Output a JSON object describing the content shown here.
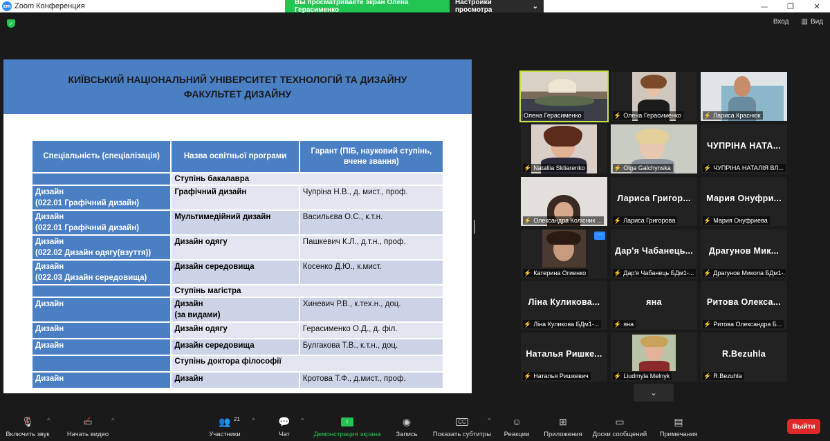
{
  "window": {
    "title": "Zoom Конференция",
    "logo": "zm",
    "share_banner": "Вы просматриваете экран Олена Герасименко",
    "view_settings": "Настройки просмотра"
  },
  "top": {
    "enter_label": "Вход",
    "view_label": "Вид"
  },
  "slide": {
    "title_line1": "КИЇВСЬКИЙ НАЦІОНАЛЬНИЙ УНІВЕРСИТЕТ  ТЕХНОЛОГІЙ ТА ДИЗАЙНУ",
    "title_line2": "ФАКУЛЬТЕТ  ДИЗАЙНУ",
    "headers": {
      "specialty": "Спеціальність (спеціалізація)",
      "program": "Назва освітньої програми",
      "guarantor": "Гарант (ПІБ, науковий ступінь, вчене звання)"
    },
    "level_bachelor": "Ступінь бакалавра",
    "level_master": "Ступінь магістра",
    "level_phd": "Ступінь доктора філософії",
    "rows": [
      {
        "spec1": "Дизайн",
        "spec2": "(022.01 Графічний дизайн)",
        "prog1": "Графічний дизайн",
        "prog2": "",
        "gar": "Чупріна Н.В., д. мист., проф."
      },
      {
        "spec1": "Дизайн",
        "spec2": "(022.01 Графічний дизайн)",
        "prog1": "Мультимедійний дизайн",
        "prog2": "",
        "gar": "Васильєва О.С., к.т.н."
      },
      {
        "spec1": "Дизайн",
        "spec2": "(022.02 Дизайн одягу(взуття))",
        "prog1": "Дизайн одягу",
        "prog2": "",
        "gar": "Пашкевич К.Л., д.т.н., проф."
      },
      {
        "spec1": "Дизайн",
        "spec2": "(022.03 Дизайн середовища)",
        "prog1": "Дизайн середовища",
        "prog2": "",
        "gar": "Косенко Д.Ю., к.мист."
      },
      {
        "spec1": "Дизайн",
        "spec2": "",
        "prog1": "Дизайн",
        "prog2": "(за видами)",
        "gar": "Хиневич Р.В., к.тех.н., доц."
      },
      {
        "spec1": "Дизайн",
        "spec2": "",
        "prog1": "Дизайн одягу",
        "prog2": "",
        "gar": "Герасименко О.Д., д. філ."
      },
      {
        "spec1": "Дизайн",
        "spec2": "",
        "prog1": "Дизайн середовища",
        "prog2": "",
        "gar": "Булгакова Т.В., к.т.н., доц."
      },
      {
        "spec1": "Дизайн",
        "spec2": "",
        "prog1": "Дизайн",
        "prog2": "",
        "gar": "Кротова Т.Ф., д.мист., проф."
      }
    ]
  },
  "participants": [
    {
      "label": "Олена Герасименко",
      "big": "",
      "muted": false
    },
    {
      "label": "Олена Герасименко",
      "big": "",
      "muted": true
    },
    {
      "label": "Лариса Краснюк",
      "big": "",
      "muted": true
    },
    {
      "label": "Nataliia Skliarenko",
      "big": "",
      "muted": true
    },
    {
      "label": "Olga Galchynska",
      "big": "",
      "muted": true
    },
    {
      "label": "ЧУПРІНА НАТАЛІЯ ВЛ...",
      "big": "ЧУПРІНА НАТА...",
      "muted": true
    },
    {
      "label": "Олександра Колісник ...",
      "big": "",
      "muted": true
    },
    {
      "label": "Лариса Григорова",
      "big": "Лариса Григор...",
      "muted": true
    },
    {
      "label": "Мария Онуфриева",
      "big": "Мария Онуфри...",
      "muted": true
    },
    {
      "label": "Катерина Огиенко",
      "big": "",
      "muted": true
    },
    {
      "label": "Дар'я Чабанець БДм1-...",
      "big": "Дар'я Чабанець...",
      "muted": true
    },
    {
      "label": "Драгунов Микола БДм1-...",
      "big": "Драгунов Мик...",
      "muted": true
    },
    {
      "label": "Ліна Куликова БДм1-...",
      "big": "Ліна Куликова...",
      "muted": true
    },
    {
      "label": "яна",
      "big": "яна",
      "muted": true
    },
    {
      "label": "Ритова Олександра Б...",
      "big": "Ритова Олекса...",
      "muted": true
    },
    {
      "label": "Наталья Ришкевич",
      "big": "Наталья Ришке...",
      "muted": true
    },
    {
      "label": "Liudmyla Melnyk",
      "big": "",
      "muted": true
    },
    {
      "label": "R.Bezuhla",
      "big": "R.Bezuhla",
      "muted": true
    }
  ],
  "toolbar": {
    "audio": "Включить звук",
    "video": "Начать видео",
    "participants": "Участники",
    "participants_count": "21",
    "chat": "Чат",
    "share": "Демонстрация экрана",
    "record": "Запись",
    "captions": "Показать субтитры",
    "reactions": "Реакции",
    "apps": "Приложения",
    "whiteboards": "Доски сообщений",
    "notes": "Примечания",
    "leave": "Выйти"
  }
}
